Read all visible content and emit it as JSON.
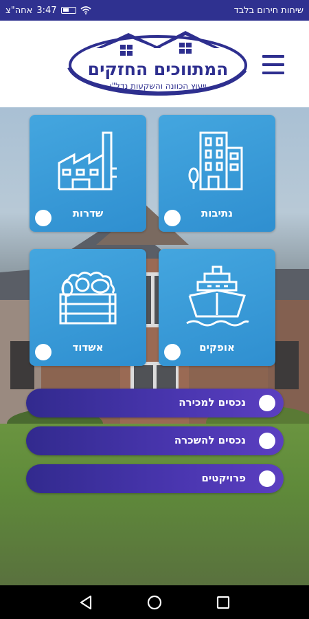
{
  "status_bar": {
    "time": "3:47",
    "meridiem": "אחה\"צ",
    "carrier": "שיחות חירום בלבד"
  },
  "header": {
    "logo_title": "המתווכים החזקים",
    "logo_subtitle": "ייעוץ הכוונה והשקעות נדל\"ן",
    "menu_icon": "hamburger-menu-icon"
  },
  "tiles": [
    {
      "label": "נתיבות",
      "icon": "buildings-icon"
    },
    {
      "label": "שדרות",
      "icon": "factory-icon"
    },
    {
      "label": "אופקים",
      "icon": "ship-icon"
    },
    {
      "label": "אשדוד",
      "icon": "vegetable-crate-icon"
    }
  ],
  "pills": [
    {
      "label": "נכסים למכירה"
    },
    {
      "label": "נכסים להשכרה"
    },
    {
      "label": "פרויקטים"
    }
  ],
  "nav": {
    "back_icon": "back-triangle-icon",
    "home_icon": "home-circle-icon",
    "recents_icon": "recents-square-icon"
  },
  "colors": {
    "primary": "#2e2f8f",
    "tile": "#3a9ad8",
    "pill": "#3b2fa0"
  }
}
